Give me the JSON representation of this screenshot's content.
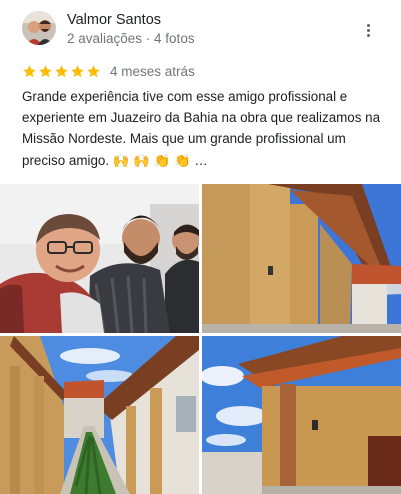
{
  "reviewer": {
    "name": "Valmor Santos",
    "meta": "2 avaliações · 4 fotos"
  },
  "review": {
    "rating": 5,
    "max_rating": 5,
    "date": "4 meses atrás",
    "text": "Grande experiência tive com esse amigo profissional e experiente em Juazeiro da Bahia na obra que realizamos na Missão Nordeste. Mais que um grande profissional um preciso amigo. 🙌 🙌 👏 👏 …"
  },
  "icons": {
    "star": "star-icon",
    "more": "more-vert-icon"
  },
  "colors": {
    "star": "#fbbc04",
    "secondary_text": "#70757a"
  },
  "photos": [
    {
      "name": "selfie-photo"
    },
    {
      "name": "building-corridor-photo"
    },
    {
      "name": "garden-walkway-photo"
    },
    {
      "name": "building-exterior-photo"
    }
  ]
}
